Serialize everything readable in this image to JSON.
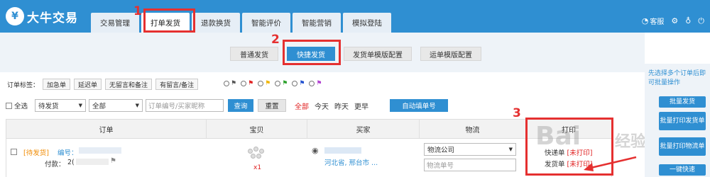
{
  "header": {
    "logo_char": "¥",
    "logo_text": "大牛交易",
    "tabs": [
      "交易管理",
      "打单发货",
      "退款换货",
      "智能评价",
      "智能营销",
      "模拟登陆"
    ],
    "right_items": [
      "客服"
    ]
  },
  "steps": [
    "1",
    "2",
    "3"
  ],
  "subtabs": [
    "普通发货",
    "快捷发货",
    "发货单模版配置",
    "运单模版配置"
  ],
  "filters": {
    "tag_label": "订单标签：",
    "tags": [
      "加急单",
      "延迟单",
      "无留言和备注",
      "有留言/备注"
    ],
    "flag_colors": [
      "#555555",
      "#e02020",
      "#f0b400",
      "#2aa02a",
      "#2050d0",
      "#b040d0"
    ],
    "select_all": "全选",
    "status_value": "待发货",
    "range_value": "全部",
    "search_placeholder": "订单编号/买家昵称",
    "query_btn": "查询",
    "reset_btn": "重置",
    "quick_links": [
      "全部",
      "今天",
      "昨天",
      "更早"
    ],
    "auto_fill_btn": "自动填单号"
  },
  "table": {
    "headers": [
      "订单",
      "宝贝",
      "买家",
      "物流",
      "打印"
    ],
    "row": {
      "status": "[待发货]",
      "order_no_label": "编号：",
      "paid_label": "付款：",
      "paid_value": "2(",
      "qty": "x1",
      "buyer_location": "河北省, 邢台市 ...",
      "logistics_value": "物流公司",
      "logistics_placeholder": "物流单号",
      "print_rows": [
        {
          "label": "快递单",
          "status": "[未打印]"
        },
        {
          "label": "发货单",
          "status": "[未打印]"
        }
      ]
    }
  },
  "right_panel": {
    "tip": "先选择多个订单后即可批量操作",
    "buttons": [
      "批量发货",
      "批量打印发货单",
      "批量打印物流单",
      "一键快速"
    ]
  },
  "watermark": {
    "text": "Bai",
    "cn": "经验"
  }
}
